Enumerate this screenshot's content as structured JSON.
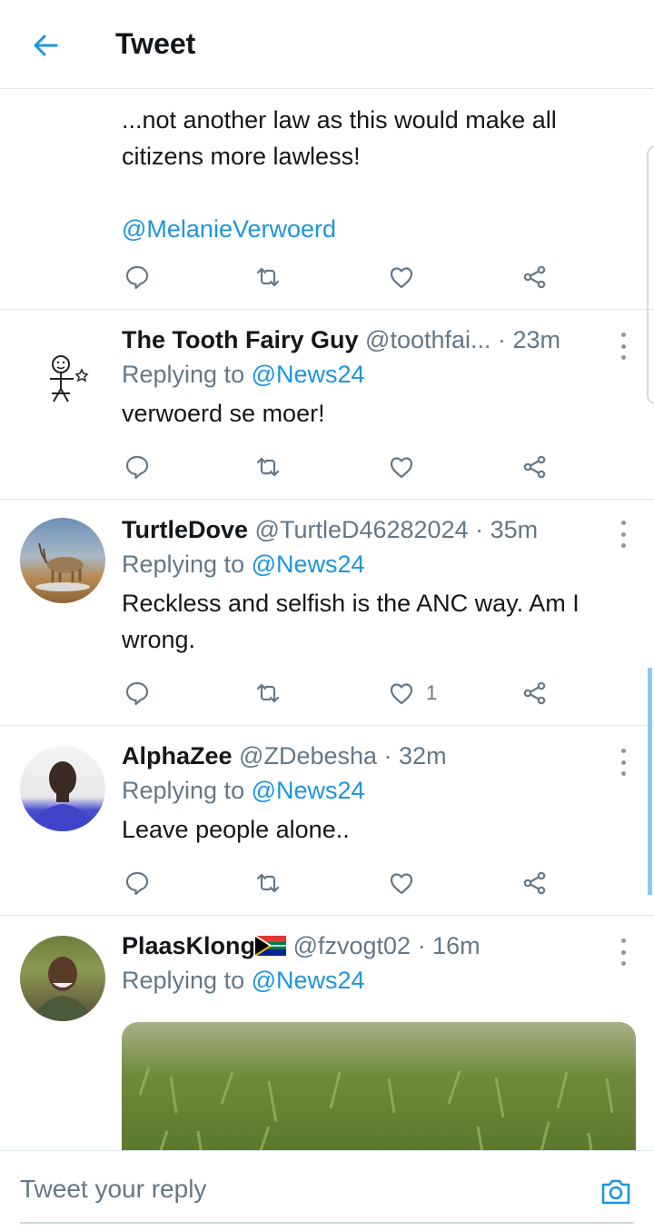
{
  "header": {
    "title": "Tweet"
  },
  "first_tweet": {
    "text": "...not another law as this would make all citizens more lawless!",
    "mention": "@MelanieVerwoerd"
  },
  "replies": [
    {
      "name": "The Tooth Fairy Guy",
      "handle": "@toothfai...",
      "time": "· 23m",
      "replying_prefix": "Replying to ",
      "replying_to": "@News24",
      "text": "verwoerd se moer!"
    },
    {
      "name": "TurtleDove",
      "handle": "@TurtleD46282024",
      "time": "· 35m",
      "replying_prefix": "Replying to ",
      "replying_to": "@News24",
      "text": "Reckless and selfish is the ANC way. Am I wrong.",
      "like_count": "1"
    },
    {
      "name": "AlphaZee",
      "handle": "@ZDebesha",
      "time": "· 32m",
      "replying_prefix": "Replying to ",
      "replying_to": "@News24",
      "text": "Leave people alone.."
    },
    {
      "name": "PlaasKlong",
      "handle": "@fzvogt02",
      "time": "· 16m",
      "replying_prefix": "Replying to ",
      "replying_to": "@News24"
    }
  ],
  "composer": {
    "placeholder": "Tweet your reply"
  },
  "colors": {
    "accent": "#1b95e0",
    "secondary_text": "#657786",
    "divider": "#e1e8ed"
  }
}
